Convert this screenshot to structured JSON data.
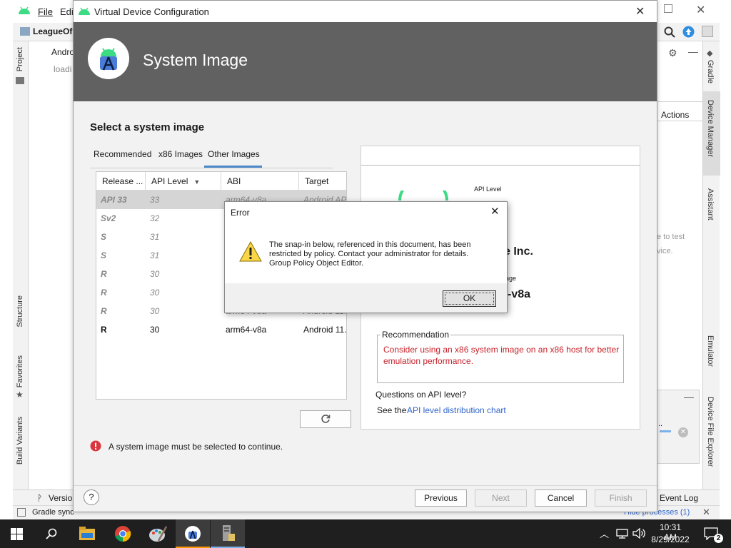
{
  "ide": {
    "menu": {
      "file": "File",
      "edit": "Edi"
    },
    "project_name": "LeagueOf",
    "android_node": "Andro",
    "loading_text": "loadi",
    "left_tabs": {
      "project": "Project",
      "structure": "Structure",
      "favorites": "Favorites",
      "build_variants": "Build Variants"
    },
    "right_tabs": {
      "gradle": "Gradle",
      "device_manager": "Device Manager",
      "assistant": "Assistant",
      "emulator": "Emulator",
      "device_file_explorer": "Device File Explorer"
    },
    "actions_label": "Actions",
    "side_text_1": "e to test",
    "side_text_2": "vice.",
    "version_tab": "Version",
    "event_log": "Event Log",
    "status_text": "Gradle sync",
    "hide_processes": "Hide processes (1)"
  },
  "dialog": {
    "title": "Virtual Device Configuration",
    "header_title": "System Image",
    "section_title": "Select a system image",
    "tabs": [
      "Recommended",
      "x86 Images",
      "Other Images"
    ],
    "active_tab": "Other Images",
    "columns": [
      "Release ...",
      "API Level",
      "ABI",
      "Target"
    ],
    "rows": [
      {
        "release": "API 33",
        "api": "33",
        "abi": "arm64-v8a",
        "target": "Android API",
        "style": "selected"
      },
      {
        "release": "Sv2",
        "api": "32",
        "abi": "",
        "target": "",
        "style": "gray"
      },
      {
        "release": "S",
        "api": "31",
        "abi": "",
        "target": "",
        "style": "gray"
      },
      {
        "release": "S",
        "api": "31",
        "abi": "",
        "target": "",
        "style": "gray"
      },
      {
        "release": "R",
        "api": "30",
        "abi": "",
        "target": "",
        "style": "gray"
      },
      {
        "release": "R",
        "api": "30",
        "abi": "",
        "target": "",
        "style": "gray"
      },
      {
        "release": "R",
        "api": "30",
        "abi": "arm64-v8a",
        "target": "Android 11.",
        "style": "gray"
      },
      {
        "release": "R",
        "api": "30",
        "abi": "arm64-v8a",
        "target": "Android 11.",
        "style": "normal"
      }
    ],
    "detail": {
      "api_level_label": "API Level",
      "vendor_fragment": "e Inc.",
      "image_label_fragment": "age",
      "abi_fragment": "-v8a",
      "recommendation_title": "Recommendation",
      "recommendation_text": "Consider using an x86 system image on an x86 host for better emulation performance.",
      "questions": "Questions on API level?",
      "see_the": "See the",
      "chart_link": "API level distribution chart"
    },
    "error_message": "A system image must be selected to continue.",
    "buttons": {
      "help": "?",
      "previous": "Previous",
      "next": "Next",
      "cancel": "Cancel",
      "finish": "Finish"
    }
  },
  "error_dialog": {
    "title": "Error",
    "message_line1": "The snap-in below, referenced in this document, has been",
    "message_line2": "restricted by policy. Contact your administrator for details.",
    "message_line3": "Group Policy Object Editor.",
    "ok": "OK"
  },
  "taskbar": {
    "time": "10:31 AM",
    "date": "8/29/2022",
    "notification_count": "2"
  },
  "colors": {
    "header_bg": "#616161",
    "accent_blue": "#2f65ca",
    "error_red": "#c7222a",
    "tab_underline": "#4a88c7"
  }
}
